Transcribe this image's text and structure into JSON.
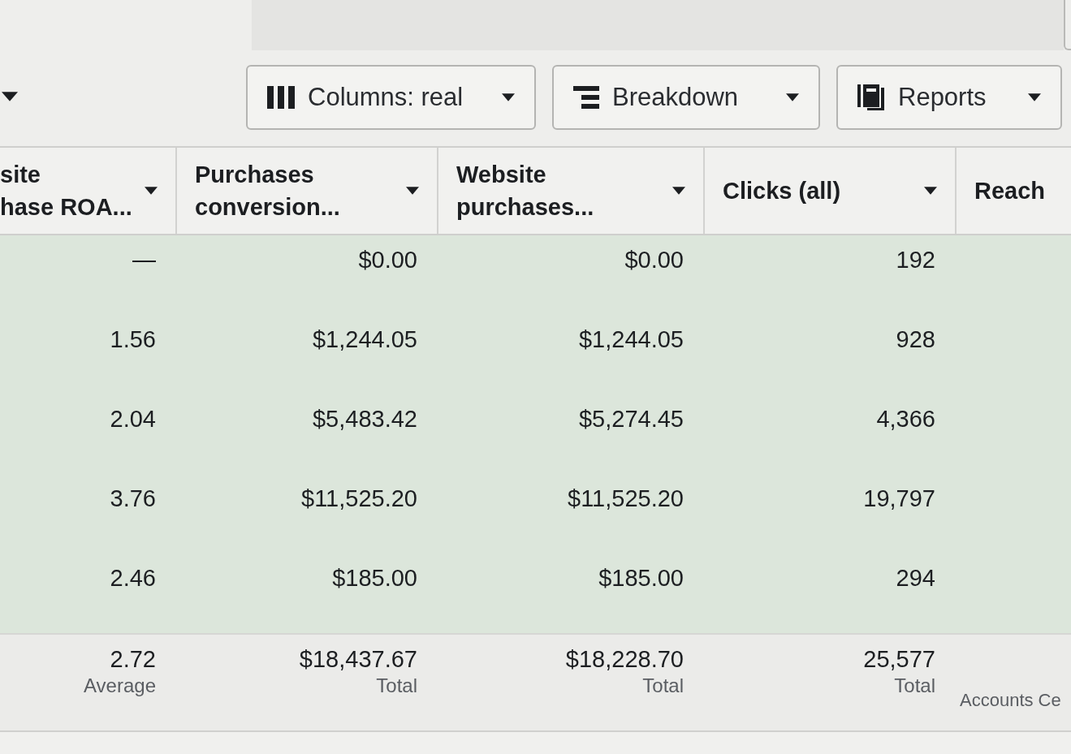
{
  "toolbar": {
    "buttons": [
      {
        "kind": "columns",
        "label": "Columns: real"
      },
      {
        "kind": "breakdown",
        "label": "Breakdown"
      },
      {
        "kind": "reports",
        "label": "Reports"
      }
    ]
  },
  "table": {
    "columns": [
      {
        "lines": [
          "site",
          "hase ROA..."
        ],
        "dropdown": true
      },
      {
        "lines": [
          "Purchases",
          "conversion..."
        ],
        "dropdown": true
      },
      {
        "lines": [
          "Website",
          "purchases..."
        ],
        "dropdown": true
      },
      {
        "lines": [
          "Clicks (all)"
        ],
        "dropdown": true
      },
      {
        "lines": [
          "Reach"
        ],
        "dropdown": false
      }
    ],
    "rows": [
      {
        "selected": true,
        "cells": [
          "—",
          "$0.00",
          "$0.00",
          "192"
        ]
      },
      {
        "selected": true,
        "cells": [
          "1.56",
          "$1,244.05",
          "$1,244.05",
          "928"
        ]
      },
      {
        "selected": true,
        "cells": [
          "2.04",
          "$5,483.42",
          "$5,274.45",
          "4,366"
        ]
      },
      {
        "selected": true,
        "cells": [
          "3.76",
          "$11,525.20",
          "$11,525.20",
          "19,797"
        ]
      },
      {
        "selected": true,
        "cells": [
          "2.46",
          "$185.00",
          "$185.00",
          "294"
        ]
      }
    ],
    "footer": [
      {
        "kind": "summary",
        "value": "2.72",
        "label": "Average"
      },
      {
        "kind": "summary",
        "value": "$18,437.67",
        "label": "Total"
      },
      {
        "kind": "summary",
        "value": "$18,228.70",
        "label": "Total"
      },
      {
        "kind": "summary",
        "value": "25,577",
        "label": "Total"
      },
      {
        "kind": "note",
        "label": "Accounts Ce"
      }
    ]
  }
}
